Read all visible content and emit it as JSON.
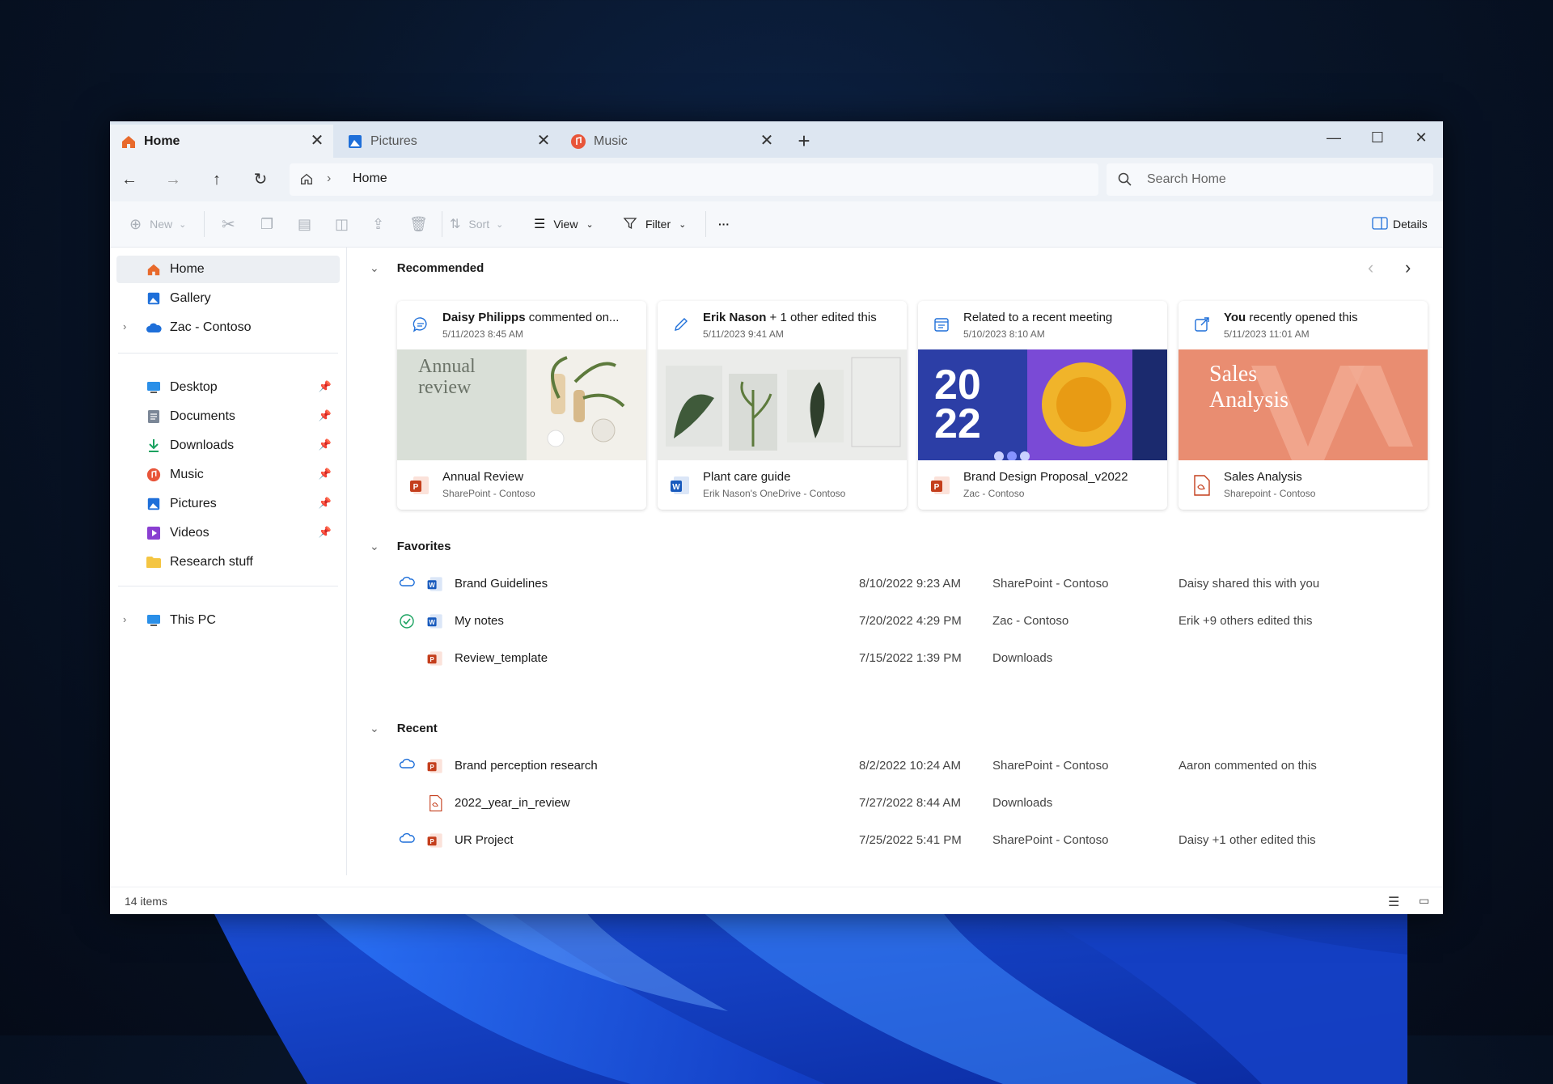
{
  "tabs": [
    {
      "label": "Home",
      "icon": "home-icon"
    },
    {
      "label": "Pictures",
      "icon": "pictures-icon"
    },
    {
      "label": "Music",
      "icon": "music-icon"
    }
  ],
  "new_tab": "+",
  "window_controls": {
    "minimize": "—",
    "maximize": "☐",
    "close": "✕"
  },
  "nav": {
    "back": "←",
    "forward": "→",
    "up": "↑",
    "refresh": "↻"
  },
  "address": {
    "path": "Home",
    "separator": "›"
  },
  "search": {
    "placeholder": "Search Home"
  },
  "toolbar": {
    "new": "New",
    "sort": "Sort",
    "view": "View",
    "filter": "Filter",
    "more": "···",
    "details": "Details"
  },
  "sidebar": {
    "top": [
      {
        "label": "Home",
        "icon": "home-icon"
      },
      {
        "label": "Gallery",
        "icon": "gallery-icon"
      },
      {
        "label": "Zac - Contoso",
        "icon": "cloud-icon"
      }
    ],
    "quick": [
      {
        "label": "Desktop",
        "icon": "desktop-icon"
      },
      {
        "label": "Documents",
        "icon": "documents-icon"
      },
      {
        "label": "Downloads",
        "icon": "downloads-icon"
      },
      {
        "label": "Music",
        "icon": "music-icon"
      },
      {
        "label": "Pictures",
        "icon": "pictures-icon"
      },
      {
        "label": "Videos",
        "icon": "videos-icon"
      },
      {
        "label": "Research stuff",
        "icon": "folder-icon"
      }
    ],
    "bottom": [
      {
        "label": "This PC",
        "icon": "pc-icon"
      }
    ]
  },
  "recommended": {
    "title": "Recommended",
    "cards": [
      {
        "actor": "Daisy Philipps",
        "action": " commented on...",
        "time": "5/11/2023 8:45 AM",
        "file": "Annual Review",
        "location": "SharePoint - Contoso",
        "thumb_text": "Annual review"
      },
      {
        "actor": "Erik Nason",
        "action": " + 1 other edited this",
        "time": "5/11/2023 9:41 AM",
        "file": "Plant care guide",
        "location": "Erik Nason's OneDrive - Contoso"
      },
      {
        "actor": "",
        "action": "Related to a recent meeting",
        "time": "5/10/2023 8:10 AM",
        "file": "Brand Design Proposal_v2022",
        "location": "Zac - Contoso",
        "thumb_text_1": "20",
        "thumb_text_2": "22"
      },
      {
        "actor": "You",
        "action": " recently opened this",
        "time": "5/11/2023 11:01 AM",
        "file": "Sales Analysis",
        "location": "Sharepoint - Contoso",
        "thumb_text_1": "Sales",
        "thumb_text_2": "Analysis"
      }
    ]
  },
  "favorites": {
    "title": "Favorites",
    "rows": [
      {
        "name": "Brand Guidelines",
        "date": "8/10/2022 9:23 AM",
        "location": "SharePoint - Contoso",
        "activity": "Daisy shared this with you",
        "status": "cloud",
        "type": "word"
      },
      {
        "name": "My notes",
        "date": "7/20/2022 4:29 PM",
        "location": "Zac - Contoso",
        "activity": "Erik +9 others edited this",
        "status": "synced",
        "type": "word"
      },
      {
        "name": "Review_template",
        "date": "7/15/2022 1:39 PM",
        "location": "Downloads",
        "activity": "",
        "status": "",
        "type": "ppt"
      }
    ]
  },
  "recent": {
    "title": "Recent",
    "rows": [
      {
        "name": "Brand perception research",
        "date": "8/2/2022 10:24 AM",
        "location": "SharePoint - Contoso",
        "activity": "Aaron commented on this",
        "status": "cloud",
        "type": "ppt"
      },
      {
        "name": "2022_year_in_review",
        "date": "7/27/2022 8:44 AM",
        "location": "Downloads",
        "activity": "",
        "status": "",
        "type": "pdf"
      },
      {
        "name": "UR Project",
        "date": "7/25/2022 5:41 PM",
        "location": "SharePoint - Contoso",
        "activity": "Daisy +1 other edited this",
        "status": "cloud",
        "type": "ppt"
      }
    ]
  },
  "status": {
    "items": "14 items"
  },
  "colors": {
    "accent": "#0067c0",
    "ppt": "#c43e1c",
    "word": "#185abd",
    "folder": "#f4c542"
  }
}
